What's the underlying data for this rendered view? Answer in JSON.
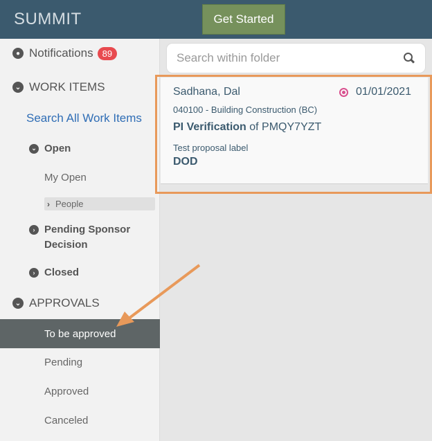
{
  "header": {
    "logo": "SUMMIT",
    "get_started_label": "Get Started"
  },
  "sidebar": {
    "notifications": {
      "label": "Notifications",
      "count": "89"
    },
    "work_items": {
      "label": "WORK ITEMS",
      "search_all": "Search All Work Items",
      "open": {
        "label": "Open",
        "my_open": "My Open",
        "people": "People"
      },
      "pending_sponsor": "Pending Sponsor Decision",
      "closed": "Closed"
    },
    "approvals": {
      "label": "APPROVALS",
      "items": [
        "To be approved",
        "Pending",
        "Approved",
        "Canceled"
      ],
      "active": "To be approved"
    }
  },
  "main": {
    "search": {
      "placeholder": "Search within folder",
      "value": ""
    },
    "card": {
      "name": "Sadhana, Dal",
      "date": "01/01/2021",
      "department": "040100 - Building Construction (BC)",
      "title_bold": "PI Verification",
      "title_rest": " of PMQY7YZT",
      "label": "Test proposal label",
      "sponsor": "DOD"
    }
  },
  "colors": {
    "header_bg": "#3b5a6e",
    "button_green": "#76915c",
    "badge_red": "#e84a4f",
    "active_row": "#5e6566",
    "highlight_orange": "#e8995a",
    "link_blue": "#2f6db5",
    "status_pink": "#d94f8e"
  }
}
